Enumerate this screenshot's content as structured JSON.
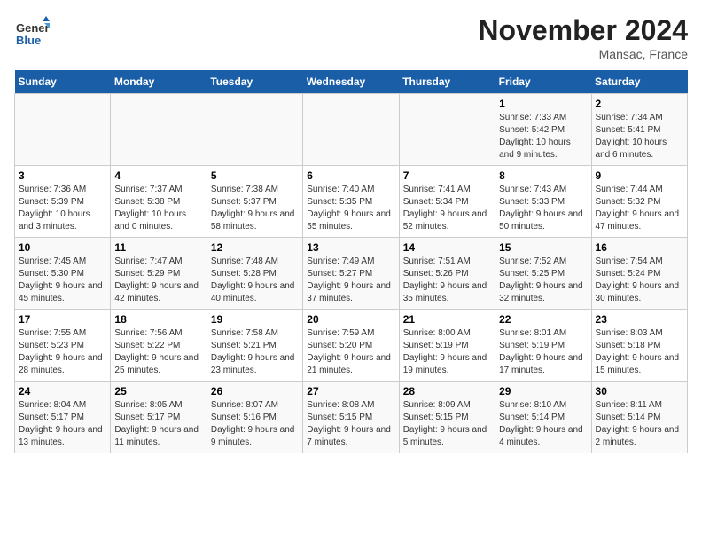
{
  "header": {
    "logo_general": "General",
    "logo_blue": "Blue",
    "month_title": "November 2024",
    "location": "Mansac, France"
  },
  "weekdays": [
    "Sunday",
    "Monday",
    "Tuesday",
    "Wednesday",
    "Thursday",
    "Friday",
    "Saturday"
  ],
  "weeks": [
    [
      {
        "day": "",
        "text": ""
      },
      {
        "day": "",
        "text": ""
      },
      {
        "day": "",
        "text": ""
      },
      {
        "day": "",
        "text": ""
      },
      {
        "day": "",
        "text": ""
      },
      {
        "day": "1",
        "text": "Sunrise: 7:33 AM\nSunset: 5:42 PM\nDaylight: 10 hours and 9 minutes."
      },
      {
        "day": "2",
        "text": "Sunrise: 7:34 AM\nSunset: 5:41 PM\nDaylight: 10 hours and 6 minutes."
      }
    ],
    [
      {
        "day": "3",
        "text": "Sunrise: 7:36 AM\nSunset: 5:39 PM\nDaylight: 10 hours and 3 minutes."
      },
      {
        "day": "4",
        "text": "Sunrise: 7:37 AM\nSunset: 5:38 PM\nDaylight: 10 hours and 0 minutes."
      },
      {
        "day": "5",
        "text": "Sunrise: 7:38 AM\nSunset: 5:37 PM\nDaylight: 9 hours and 58 minutes."
      },
      {
        "day": "6",
        "text": "Sunrise: 7:40 AM\nSunset: 5:35 PM\nDaylight: 9 hours and 55 minutes."
      },
      {
        "day": "7",
        "text": "Sunrise: 7:41 AM\nSunset: 5:34 PM\nDaylight: 9 hours and 52 minutes."
      },
      {
        "day": "8",
        "text": "Sunrise: 7:43 AM\nSunset: 5:33 PM\nDaylight: 9 hours and 50 minutes."
      },
      {
        "day": "9",
        "text": "Sunrise: 7:44 AM\nSunset: 5:32 PM\nDaylight: 9 hours and 47 minutes."
      }
    ],
    [
      {
        "day": "10",
        "text": "Sunrise: 7:45 AM\nSunset: 5:30 PM\nDaylight: 9 hours and 45 minutes."
      },
      {
        "day": "11",
        "text": "Sunrise: 7:47 AM\nSunset: 5:29 PM\nDaylight: 9 hours and 42 minutes."
      },
      {
        "day": "12",
        "text": "Sunrise: 7:48 AM\nSunset: 5:28 PM\nDaylight: 9 hours and 40 minutes."
      },
      {
        "day": "13",
        "text": "Sunrise: 7:49 AM\nSunset: 5:27 PM\nDaylight: 9 hours and 37 minutes."
      },
      {
        "day": "14",
        "text": "Sunrise: 7:51 AM\nSunset: 5:26 PM\nDaylight: 9 hours and 35 minutes."
      },
      {
        "day": "15",
        "text": "Sunrise: 7:52 AM\nSunset: 5:25 PM\nDaylight: 9 hours and 32 minutes."
      },
      {
        "day": "16",
        "text": "Sunrise: 7:54 AM\nSunset: 5:24 PM\nDaylight: 9 hours and 30 minutes."
      }
    ],
    [
      {
        "day": "17",
        "text": "Sunrise: 7:55 AM\nSunset: 5:23 PM\nDaylight: 9 hours and 28 minutes."
      },
      {
        "day": "18",
        "text": "Sunrise: 7:56 AM\nSunset: 5:22 PM\nDaylight: 9 hours and 25 minutes."
      },
      {
        "day": "19",
        "text": "Sunrise: 7:58 AM\nSunset: 5:21 PM\nDaylight: 9 hours and 23 minutes."
      },
      {
        "day": "20",
        "text": "Sunrise: 7:59 AM\nSunset: 5:20 PM\nDaylight: 9 hours and 21 minutes."
      },
      {
        "day": "21",
        "text": "Sunrise: 8:00 AM\nSunset: 5:19 PM\nDaylight: 9 hours and 19 minutes."
      },
      {
        "day": "22",
        "text": "Sunrise: 8:01 AM\nSunset: 5:19 PM\nDaylight: 9 hours and 17 minutes."
      },
      {
        "day": "23",
        "text": "Sunrise: 8:03 AM\nSunset: 5:18 PM\nDaylight: 9 hours and 15 minutes."
      }
    ],
    [
      {
        "day": "24",
        "text": "Sunrise: 8:04 AM\nSunset: 5:17 PM\nDaylight: 9 hours and 13 minutes."
      },
      {
        "day": "25",
        "text": "Sunrise: 8:05 AM\nSunset: 5:17 PM\nDaylight: 9 hours and 11 minutes."
      },
      {
        "day": "26",
        "text": "Sunrise: 8:07 AM\nSunset: 5:16 PM\nDaylight: 9 hours and 9 minutes."
      },
      {
        "day": "27",
        "text": "Sunrise: 8:08 AM\nSunset: 5:15 PM\nDaylight: 9 hours and 7 minutes."
      },
      {
        "day": "28",
        "text": "Sunrise: 8:09 AM\nSunset: 5:15 PM\nDaylight: 9 hours and 5 minutes."
      },
      {
        "day": "29",
        "text": "Sunrise: 8:10 AM\nSunset: 5:14 PM\nDaylight: 9 hours and 4 minutes."
      },
      {
        "day": "30",
        "text": "Sunrise: 8:11 AM\nSunset: 5:14 PM\nDaylight: 9 hours and 2 minutes."
      }
    ]
  ]
}
